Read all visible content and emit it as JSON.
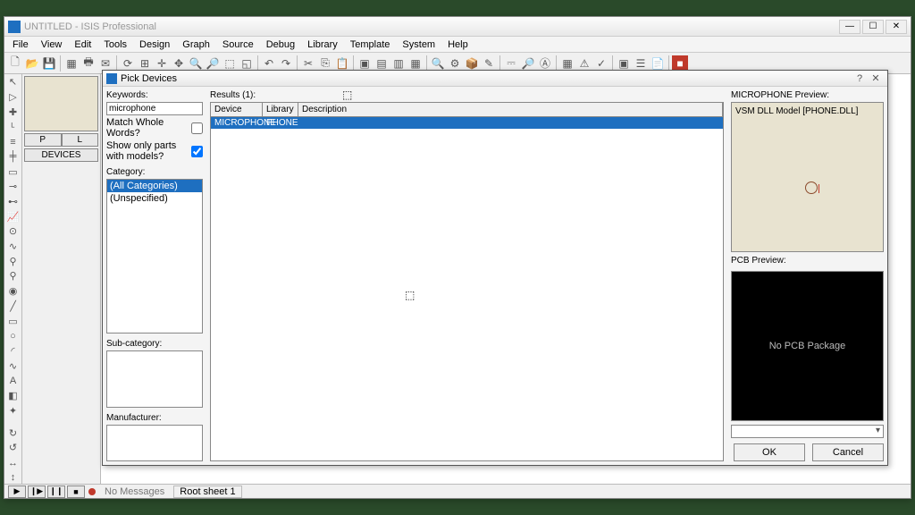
{
  "titlebar": {
    "text": "UNTITLED - ISIS Professional"
  },
  "window_controls": {
    "min": "—",
    "max": "☐",
    "close": "✕"
  },
  "menubar": [
    "File",
    "View",
    "Edit",
    "Tools",
    "Design",
    "Graph",
    "Source",
    "Debug",
    "Library",
    "Template",
    "System",
    "Help"
  ],
  "leftpanel": {
    "pl_p": "P",
    "pl_l": "L",
    "devices": "DEVICES"
  },
  "statusbar": {
    "nomsg": "No Messages",
    "sheet": "Root sheet 1",
    "play": "▶",
    "step": "❙▶",
    "pause": "❙❙",
    "stop": "■"
  },
  "dialog": {
    "title": "Pick Devices",
    "help": "?",
    "close": "✕",
    "keywords_label": "Keywords:",
    "keywords_value": "microphone",
    "match_whole": "Match Whole Words?",
    "show_only": "Show only parts with models?",
    "category_label": "Category:",
    "categories": [
      "(All Categories)",
      "(Unspecified)"
    ],
    "subcategory_label": "Sub-category:",
    "manufacturer_label": "Manufacturer:",
    "results_label": "Results (1):",
    "cols": {
      "device": "Device",
      "library": "Library",
      "desc": "Description"
    },
    "row": {
      "device": "MICROPHONE",
      "library": "PHONE",
      "desc": ""
    },
    "preview_label": "MICROPHONE Preview:",
    "model_text": "VSM DLL Model [PHONE.DLL]",
    "pcb_label": "PCB Preview:",
    "pcb_text": "No PCB Package",
    "ok": "OK",
    "cancel": "Cancel"
  }
}
